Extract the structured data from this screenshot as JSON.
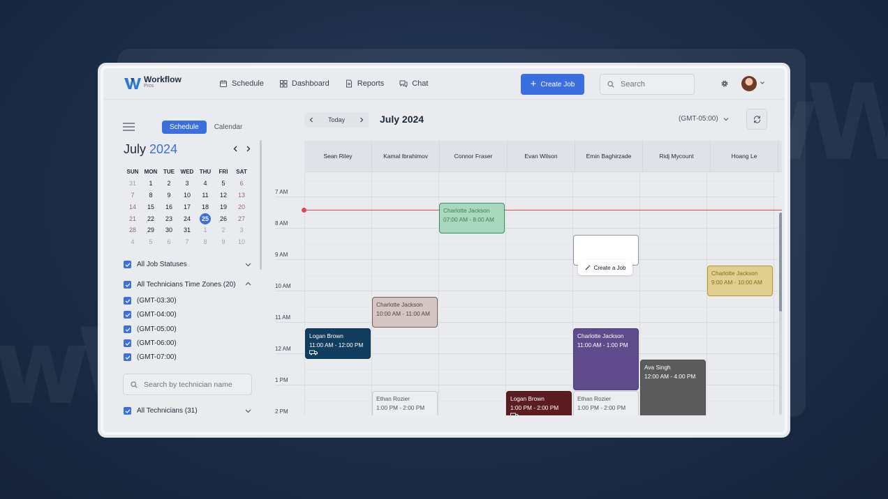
{
  "brand": {
    "name": "Workflow",
    "sub": "Pros"
  },
  "nav": [
    {
      "label": "Schedule",
      "icon": "calendar-icon"
    },
    {
      "label": "Dashboard",
      "icon": "grid-icon"
    },
    {
      "label": "Reports",
      "icon": "document-icon"
    },
    {
      "label": "Chat",
      "icon": "chat-icon"
    }
  ],
  "header": {
    "create_job": "Create Job",
    "search_placeholder": "Search"
  },
  "sidebar": {
    "view_toggle": [
      "Schedule",
      "Calendar"
    ],
    "month": "July",
    "year": "2024",
    "weekdays": [
      "SUN",
      "MON",
      "TUE",
      "WED",
      "THU",
      "FRI",
      "SAT"
    ],
    "weeks": [
      [
        "31",
        "1",
        "2",
        "3",
        "4",
        "5",
        "6"
      ],
      [
        "7",
        "8",
        "9",
        "10",
        "11",
        "12",
        "13"
      ],
      [
        "14",
        "15",
        "16",
        "17",
        "18",
        "19",
        "20"
      ],
      [
        "21",
        "22",
        "23",
        "24",
        "25",
        "26",
        "27"
      ],
      [
        "28",
        "29",
        "30",
        "31",
        "1",
        "2",
        "3"
      ],
      [
        "4",
        "5",
        "6",
        "7",
        "8",
        "9",
        "10"
      ]
    ],
    "selected_day": "25",
    "filters": {
      "job_statuses": "All Job Statuses",
      "time_zones": "All Technicians Time Zones (20)",
      "zones": [
        "(GMT-03:30)",
        "(GMT-04:00)",
        "(GMT-05:00)",
        "(GMT-06:00)",
        "(GMT-07:00)"
      ],
      "tech_search_placeholder": "Search by technician name",
      "all_technicians": "All Technicians (31)"
    }
  },
  "toolbar": {
    "today": "Today",
    "month_heading": "July 2024",
    "timezone": "(GMT-05:00)"
  },
  "technicians": [
    "Sean Riley",
    "Kamal Ibrahimov",
    "Connor Fraser",
    "Evan Wilson",
    "Emin Baghirzade",
    "Ridj Mycount",
    "Hoang Le"
  ],
  "hours": [
    "7 AM",
    "8 AM",
    "9 AM",
    "10 AM",
    "11 AM",
    "12 AM",
    "1 PM",
    "2 PM"
  ],
  "events": [
    {
      "name": "Charlotte Jackson",
      "time": "07:00 AM - 8:00 AM",
      "bg": "#a8d8bd",
      "border": "#3f8a62",
      "color": "#3f7c58"
    },
    {
      "name": "Charlotte Jackson",
      "time": "9:00 AM - 10:00 AM",
      "bg": "#e1cf90",
      "border": "#b89627",
      "color": "#8a6d14"
    },
    {
      "name": "Charlotte Jackson",
      "time": "10:00 AM - 11:00 AM",
      "bg": "#d3c6c4",
      "border": "#7c5b58",
      "color": "#5a3f3c"
    },
    {
      "name": "Logan Brown",
      "time": "11:00 AM - 12:00 PM",
      "bg": "#113d5e",
      "border": "#0d3250",
      "color": "#ffffff"
    },
    {
      "name": "Charlotte Jackson",
      "time": "11:00 AM - 1:00 PM",
      "bg": "#5f4b8b",
      "border": "#4f3e78",
      "color": "#ffffff"
    },
    {
      "name": "Ava Singh",
      "time": "12:00 AM - 4:00 PM",
      "bg": "#5b5b5b",
      "border": "#4a4a4a",
      "color": "#ffffff"
    },
    {
      "name": "Ethan Rozier",
      "time": "1:00 PM - 2:00 PM",
      "bg": "#eceef1",
      "border": "#c4c8cf",
      "color": "#4b5563"
    },
    {
      "name": "Logan Brown",
      "time": "1:00 PM - 2:00 PM",
      "bg": "#5c1d22",
      "border": "#4a161a",
      "color": "#ffffff"
    },
    {
      "name": "Ethan Rozier",
      "time": "1:00 PM - 2:00 PM",
      "bg": "#eceef1",
      "border": "#c4c8cf",
      "color": "#4b5563"
    }
  ],
  "create_tooltip": "Create a Job"
}
